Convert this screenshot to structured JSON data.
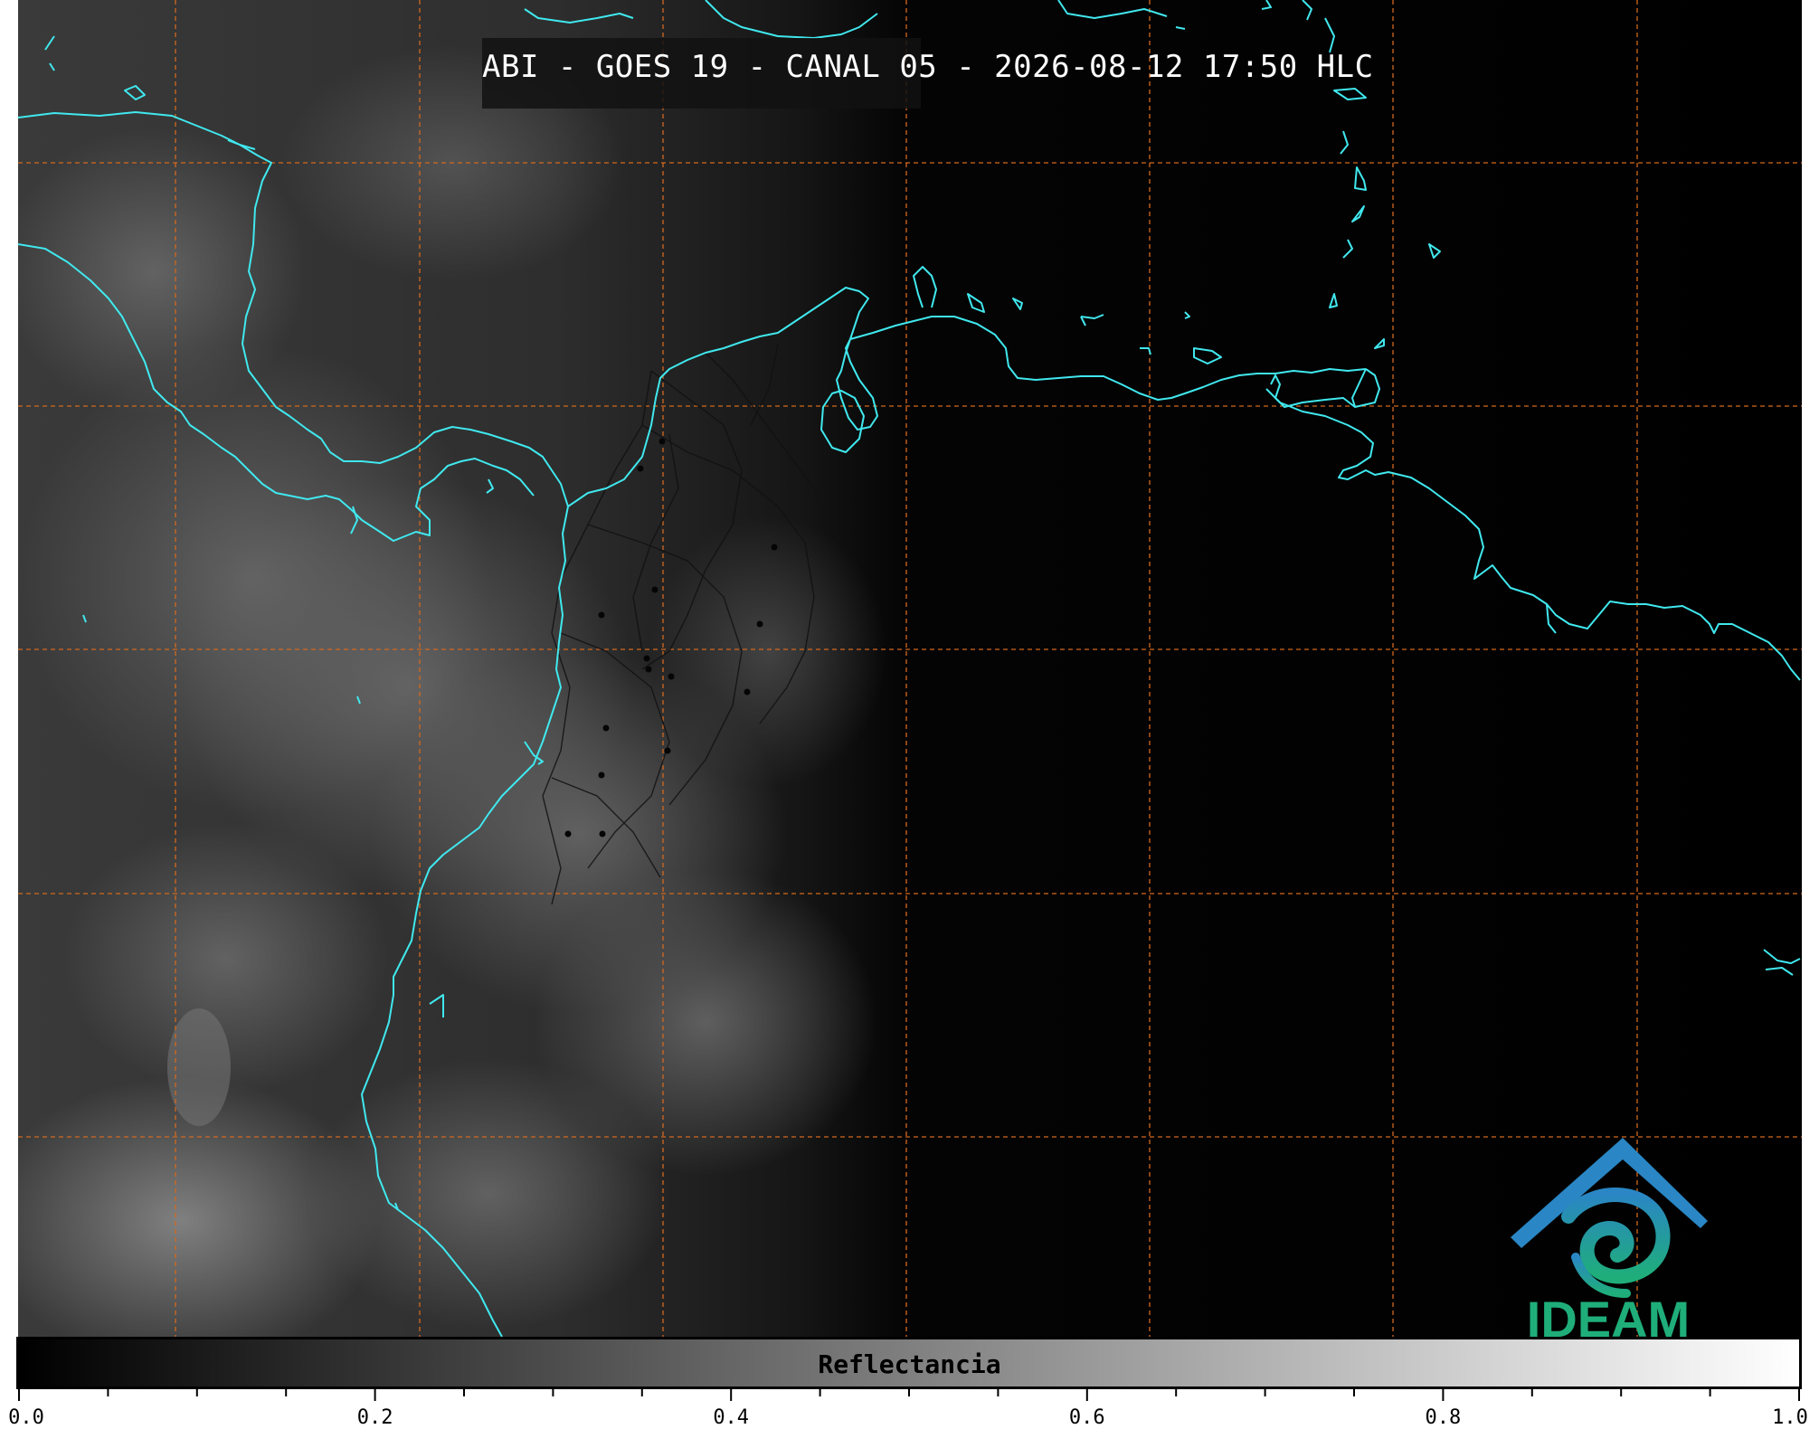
{
  "title": "ABI - GOES 19 - CANAL 05 - 2026-08-12 17:50 HLC",
  "colors": {
    "coastline": "#40e8ee",
    "grid": "#d2691e",
    "borders": "#000000",
    "logo_blue": "#2a86c4",
    "logo_green": "#1fae7a"
  },
  "logo": {
    "text": "IDEAM"
  },
  "colorbar": {
    "label": "Reflectancia",
    "range": [
      0.0,
      1.0
    ],
    "tick_labels": [
      "0.0",
      "0.2",
      "0.4",
      "0.6",
      "0.8",
      "1.0"
    ],
    "minor_ticks_per_major": 4
  },
  "gridlines": {
    "style": "dashed",
    "visible": true
  }
}
